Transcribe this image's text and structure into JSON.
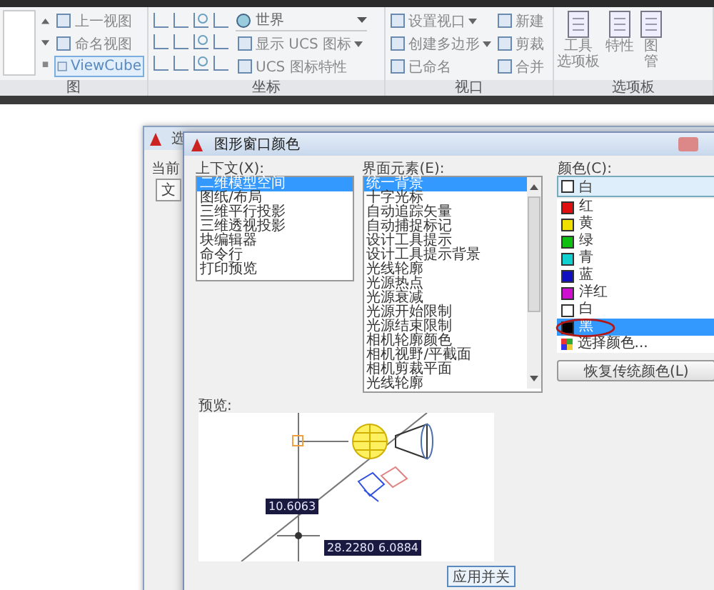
{
  "ribbon": {
    "panels": [
      {
        "title": "图",
        "items": [
          {
            "label": "上一视图",
            "kind": "small",
            "on": false
          },
          {
            "label": "命名视图",
            "kind": "small",
            "on": false
          },
          {
            "label": "ViewCube",
            "kind": "small",
            "on": true
          }
        ]
      },
      {
        "title": "坐标",
        "items": [
          {
            "label": "世界",
            "kind": "combo"
          },
          {
            "label": "显示 UCS 图标",
            "kind": "menu"
          },
          {
            "label": "UCS 图标特性",
            "kind": "small"
          }
        ]
      },
      {
        "title": "视口",
        "items": [
          {
            "label": "设置视口",
            "kind": "menu"
          },
          {
            "label": "新建",
            "kind": "small"
          },
          {
            "label": "创建多边形",
            "kind": "menu"
          },
          {
            "label": "剪裁",
            "kind": "small"
          },
          {
            "label": "已命名",
            "kind": "small"
          },
          {
            "label": "合并",
            "kind": "small"
          }
        ]
      },
      {
        "title": "选项板",
        "items": [
          {
            "lines": [
              "工具",
              "选项板"
            ],
            "kind": "large"
          },
          {
            "lines": [
              "特性"
            ],
            "kind": "large"
          },
          {
            "lines": [
              "图",
              "管"
            ],
            "kind": "large"
          }
        ]
      }
    ]
  },
  "outer_dialog": {
    "title": "选",
    "label": "当前",
    "tab": "文"
  },
  "dialog": {
    "title": "图形窗口颜色",
    "context": {
      "label": "上下文(X):",
      "items": [
        {
          "label": "二维模型空间",
          "selected": true
        },
        {
          "label": "图纸/布局",
          "selected": false
        },
        {
          "label": "三维平行投影",
          "selected": false
        },
        {
          "label": "三维透视投影",
          "selected": false
        },
        {
          "label": "块编辑器",
          "selected": false
        },
        {
          "label": "命令行",
          "selected": false
        },
        {
          "label": "打印预览",
          "selected": false
        }
      ]
    },
    "elements": {
      "label": "界面元素(E):",
      "items": [
        {
          "label": "统一背景",
          "selected": true
        },
        {
          "label": "十字光标",
          "selected": false
        },
        {
          "label": "自动追踪矢量",
          "selected": false
        },
        {
          "label": "自动捕捉标记",
          "selected": false
        },
        {
          "label": "设计工具提示",
          "selected": false
        },
        {
          "label": "设计工具提示背景",
          "selected": false
        },
        {
          "label": "光线轮廓",
          "selected": false
        },
        {
          "label": "光源热点",
          "selected": false
        },
        {
          "label": "光源衰减",
          "selected": false
        },
        {
          "label": "光源开始限制",
          "selected": false
        },
        {
          "label": "光源结束限制",
          "selected": false
        },
        {
          "label": "相机轮廓颜色",
          "selected": false
        },
        {
          "label": "相机视野/平截面",
          "selected": false
        },
        {
          "label": "相机剪裁平面",
          "selected": false
        },
        {
          "label": "光线轮廓",
          "selected": false
        }
      ]
    },
    "color": {
      "label": "颜色(C):",
      "value": {
        "label": "白",
        "color": "#ffffff"
      },
      "options": [
        {
          "label": "红",
          "color": "#e01010",
          "selected": false,
          "kind": "swatch"
        },
        {
          "label": "黄",
          "color": "#f0e000",
          "selected": false,
          "kind": "swatch"
        },
        {
          "label": "绿",
          "color": "#10c010",
          "selected": false,
          "kind": "swatch"
        },
        {
          "label": "青",
          "color": "#10d0d0",
          "selected": false,
          "kind": "swatch"
        },
        {
          "label": "蓝",
          "color": "#1010c0",
          "selected": false,
          "kind": "swatch"
        },
        {
          "label": "洋红",
          "color": "#d010d0",
          "selected": false,
          "kind": "swatch"
        },
        {
          "label": "白",
          "color": "#ffffff",
          "selected": false,
          "kind": "swatch"
        },
        {
          "label": "黑",
          "color": "#000000",
          "selected": true,
          "kind": "swatch"
        },
        {
          "label": "选择颜色...",
          "kind": "more",
          "selected": false
        }
      ]
    },
    "restore_button": "恢复传统颜色(L)",
    "preview": {
      "label": "预览:",
      "readouts": [
        "10.6063",
        "28.2280",
        "6.0884"
      ]
    },
    "apply_button": "应用并关"
  }
}
